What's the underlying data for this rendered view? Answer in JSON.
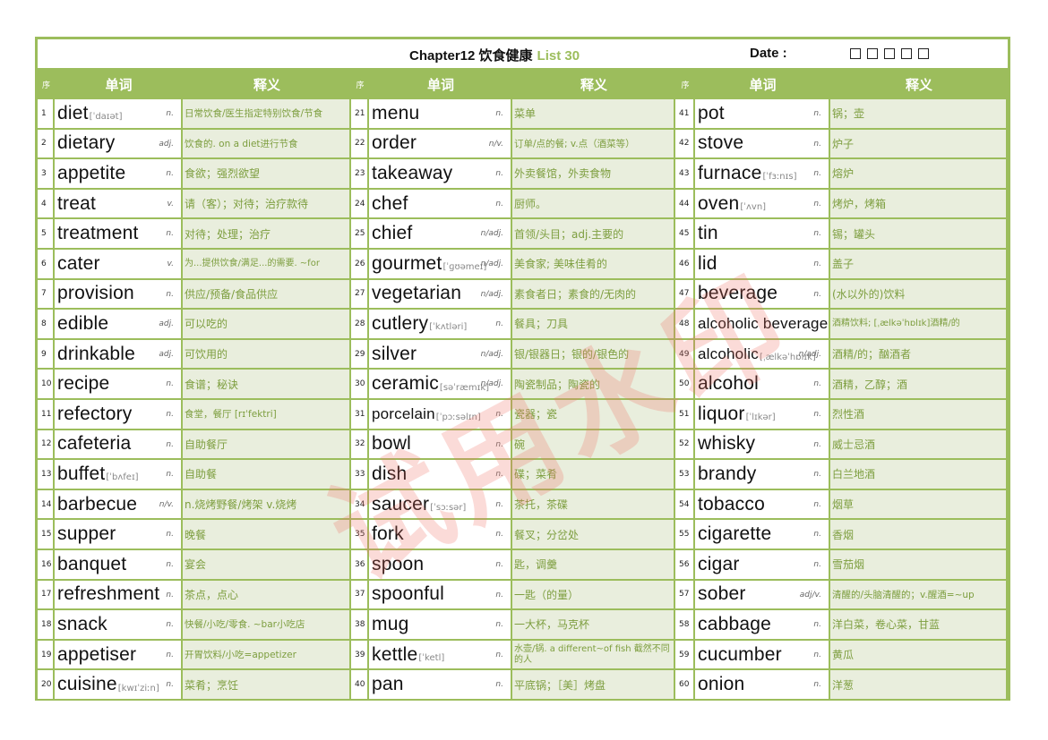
{
  "title": {
    "chapter": "Chapter12 饮食健康",
    "list": "List 30",
    "date_label": "Date :",
    "date_boxes": 5
  },
  "header": {
    "index": "序",
    "word": "单词",
    "definition": "释义"
  },
  "watermark": "试用水印",
  "colors": {
    "accent": "#9cbd5c",
    "definition_bg": "#e9eedd",
    "definition_text": "#7d9e3f"
  },
  "columns": [
    [
      {
        "n": "1",
        "word": "diet",
        "ipa": "[ˈdaɪət]",
        "pos": "n.",
        "def": "日常饮食/医生指定特别饮食/节食"
      },
      {
        "n": "2",
        "word": "dietary",
        "ipa": "",
        "pos": "adj.",
        "def": "饮食的. on a diet进行节食"
      },
      {
        "n": "3",
        "word": "appetite",
        "ipa": "",
        "pos": "n.",
        "def": "食欲；强烈欲望"
      },
      {
        "n": "4",
        "word": "treat",
        "ipa": "",
        "pos": "v.",
        "def": "请（客）；对待；治疗款待"
      },
      {
        "n": "5",
        "word": "treatment",
        "ipa": "",
        "pos": "n.",
        "def": "对待；处理；治疗"
      },
      {
        "n": "6",
        "word": "cater",
        "ipa": "",
        "pos": "v.",
        "def": "为...提供饮食/满足...的需要. ~for"
      },
      {
        "n": "7",
        "word": "provision",
        "ipa": "",
        "pos": "n.",
        "def": "供应/预备/食品供应"
      },
      {
        "n": "8",
        "word": "edible",
        "ipa": "",
        "pos": "adj.",
        "def": "可以吃的"
      },
      {
        "n": "9",
        "word": "drinkable",
        "ipa": "",
        "pos": "adj.",
        "def": "可饮用的"
      },
      {
        "n": "10",
        "word": "recipe",
        "ipa": "",
        "pos": "n.",
        "def": "食谱；秘诀"
      },
      {
        "n": "11",
        "word": "refectory",
        "ipa": "",
        "pos": "n.",
        "def": "食堂，餐厅 [rɪˈfektri]"
      },
      {
        "n": "12",
        "word": "cafeteria",
        "ipa": "",
        "pos": "n.",
        "def": "自助餐厅"
      },
      {
        "n": "13",
        "word": "buffet",
        "ipa": "[ˈbʌfeɪ]",
        "pos": "n.",
        "def": "自助餐"
      },
      {
        "n": "14",
        "word": "barbecue",
        "ipa": "",
        "pos": "n/v.",
        "def": "n.烧烤野餐/烤架 v.烧烤"
      },
      {
        "n": "15",
        "word": "supper",
        "ipa": "",
        "pos": "n.",
        "def": "晚餐"
      },
      {
        "n": "16",
        "word": "banquet",
        "ipa": "",
        "pos": "n.",
        "def": "宴会"
      },
      {
        "n": "17",
        "word": "refreshment",
        "ipa": "",
        "pos": "n.",
        "def": "茶点，点心"
      },
      {
        "n": "18",
        "word": "snack",
        "ipa": "",
        "pos": "n.",
        "def": "快餐/小吃/零食. ~bar小吃店"
      },
      {
        "n": "19",
        "word": "appetiser",
        "ipa": "",
        "pos": "n.",
        "def": "开胃饮料/小吃=appetizer"
      },
      {
        "n": "20",
        "word": "cuisine",
        "ipa": "[kwɪˈziːn]",
        "pos": "n.",
        "def": "菜肴；烹饪"
      }
    ],
    [
      {
        "n": "21",
        "word": "menu",
        "ipa": "",
        "pos": "n.",
        "def": "菜单"
      },
      {
        "n": "22",
        "word": "order",
        "ipa": "",
        "pos": "n/v.",
        "def": "订单/点的餐; v.点（酒菜等）"
      },
      {
        "n": "23",
        "word": "takeaway",
        "ipa": "",
        "pos": "n.",
        "def": "外卖餐馆，外卖食物"
      },
      {
        "n": "24",
        "word": "chef",
        "ipa": "",
        "pos": "n.",
        "def": "厨师。"
      },
      {
        "n": "25",
        "word": "chief",
        "ipa": "",
        "pos": "n/adj.",
        "def": "首领/头目；adj.主要的"
      },
      {
        "n": "26",
        "word": "gourmet",
        "ipa": "[ˈɡʊəmeɪ]",
        "pos": "n/adj.",
        "def": "美食家; 美味佳肴的"
      },
      {
        "n": "27",
        "word": "vegetarian",
        "ipa": "",
        "pos": "n/adj.",
        "def": "素食者日；素食的/无肉的"
      },
      {
        "n": "28",
        "word": "cutlery",
        "ipa": "[ˈkʌtləri]",
        "pos": "n.",
        "def": "餐具；刀具"
      },
      {
        "n": "29",
        "word": "silver",
        "ipa": "",
        "pos": "n/adj.",
        "def": "银/银器日；银的/银色的"
      },
      {
        "n": "30",
        "word": "ceramic",
        "ipa": "[səˈræmɪk]",
        "pos": "n/adj.",
        "def": "陶瓷制品；陶瓷的"
      },
      {
        "n": "31",
        "word": "porcelain",
        "ipa": "[ˈpɔːsəlɪn]",
        "pos": "n.",
        "def": "瓷器；瓷"
      },
      {
        "n": "32",
        "word": "bowl",
        "ipa": "",
        "pos": "n.",
        "def": "碗"
      },
      {
        "n": "33",
        "word": "dish",
        "ipa": "",
        "pos": "n.",
        "def": "碟；菜肴"
      },
      {
        "n": "34",
        "word": "saucer",
        "ipa": "[ˈsɔːsər]",
        "pos": "n.",
        "def": "茶托，茶碟"
      },
      {
        "n": "35",
        "word": "fork",
        "ipa": "",
        "pos": "n.",
        "def": "餐叉；分岔处"
      },
      {
        "n": "36",
        "word": "spoon",
        "ipa": "",
        "pos": "n.",
        "def": "匙，调羹"
      },
      {
        "n": "37",
        "word": "spoonful",
        "ipa": "",
        "pos": "n.",
        "def": "一匙（的量）"
      },
      {
        "n": "38",
        "word": "mug",
        "ipa": "",
        "pos": "n.",
        "def": "一大杯，马克杯"
      },
      {
        "n": "39",
        "word": "kettle",
        "ipa": "[ˈketl]",
        "pos": "n.",
        "def": "水壶/锅. a different~of fish 截然不同的人"
      },
      {
        "n": "40",
        "word": "pan",
        "ipa": "",
        "pos": "n.",
        "def": "平底锅；［美］烤盘"
      }
    ],
    [
      {
        "n": "41",
        "word": "pot",
        "ipa": "",
        "pos": "n.",
        "def": "锅；壶"
      },
      {
        "n": "42",
        "word": "stove",
        "ipa": "",
        "pos": "n.",
        "def": "炉子"
      },
      {
        "n": "43",
        "word": "furnace",
        "ipa": "[ˈfɜːnɪs]",
        "pos": "n.",
        "def": "熔炉"
      },
      {
        "n": "44",
        "word": "oven",
        "ipa": "[ˈʌvn]",
        "pos": "n.",
        "def": "烤炉，烤箱"
      },
      {
        "n": "45",
        "word": "tin",
        "ipa": "",
        "pos": "n.",
        "def": "锡；罐头"
      },
      {
        "n": "46",
        "word": "lid",
        "ipa": "",
        "pos": "n.",
        "def": "盖子"
      },
      {
        "n": "47",
        "word": "beverage",
        "ipa": "",
        "pos": "n.",
        "def": "(水以外的)饮料"
      },
      {
        "n": "48",
        "word": "alcoholic beverage",
        "ipa": "",
        "pos": "",
        "def": "酒精饮料; [ˌælkəˈhɒlɪk]酒精/的"
      },
      {
        "n": "49",
        "word": "alcoholic",
        "ipa": "[ˌælkəˈhɒlɪk]",
        "pos": "n/adj.",
        "def": "酒精/的；酗酒者"
      },
      {
        "n": "50",
        "word": "alcohol",
        "ipa": "",
        "pos": "n.",
        "def": "酒精，乙醇；酒"
      },
      {
        "n": "51",
        "word": "liquor",
        "ipa": "[ˈlɪkər]",
        "pos": "n.",
        "def": "烈性酒"
      },
      {
        "n": "52",
        "word": "whisky",
        "ipa": "",
        "pos": "n.",
        "def": "威士忌酒"
      },
      {
        "n": "53",
        "word": "brandy",
        "ipa": "",
        "pos": "n.",
        "def": "白兰地酒"
      },
      {
        "n": "54",
        "word": "tobacco",
        "ipa": "",
        "pos": "n.",
        "def": "烟草"
      },
      {
        "n": "55",
        "word": "cigarette",
        "ipa": "",
        "pos": "n.",
        "def": "香烟"
      },
      {
        "n": "56",
        "word": "cigar",
        "ipa": "",
        "pos": "n.",
        "def": "雪茄烟"
      },
      {
        "n": "57",
        "word": "sober",
        "ipa": "",
        "pos": "adj/v.",
        "def": "清醒的/头脑清醒的；v.醒酒=~up"
      },
      {
        "n": "58",
        "word": "cabbage",
        "ipa": "",
        "pos": "n.",
        "def": "洋白菜，卷心菜，甘蓝"
      },
      {
        "n": "59",
        "word": "cucumber",
        "ipa": "",
        "pos": "n.",
        "def": "黄瓜"
      },
      {
        "n": "60",
        "word": "onion",
        "ipa": "",
        "pos": "n.",
        "def": "洋葱"
      }
    ]
  ]
}
